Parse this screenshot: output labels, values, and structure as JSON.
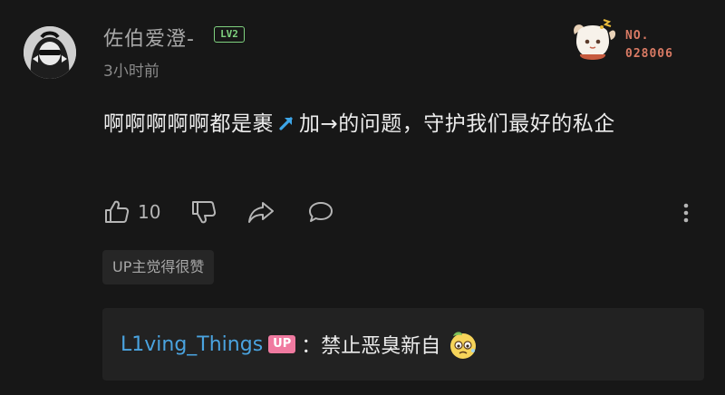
{
  "comment": {
    "username": "佐伯爱澄-",
    "level": "LV2",
    "time": "3小时前",
    "text_before": "啊啊啊啊啊都是裹",
    "text_after": "加→的问题，守护我们最好的私企",
    "badge_no_line1": "NO.",
    "badge_no_line2": "028006"
  },
  "actions": {
    "like_count": "10"
  },
  "up_liked": "UP主觉得很赞",
  "reply": {
    "name": "L1ving_Things",
    "tag": "UP",
    "text": "：禁止恶臭新自"
  },
  "colors": {
    "background": "#171717",
    "level_green": "#7fd27f",
    "reply_name_blue": "#4aa3df",
    "up_tag_pink": "#f07aa0"
  }
}
